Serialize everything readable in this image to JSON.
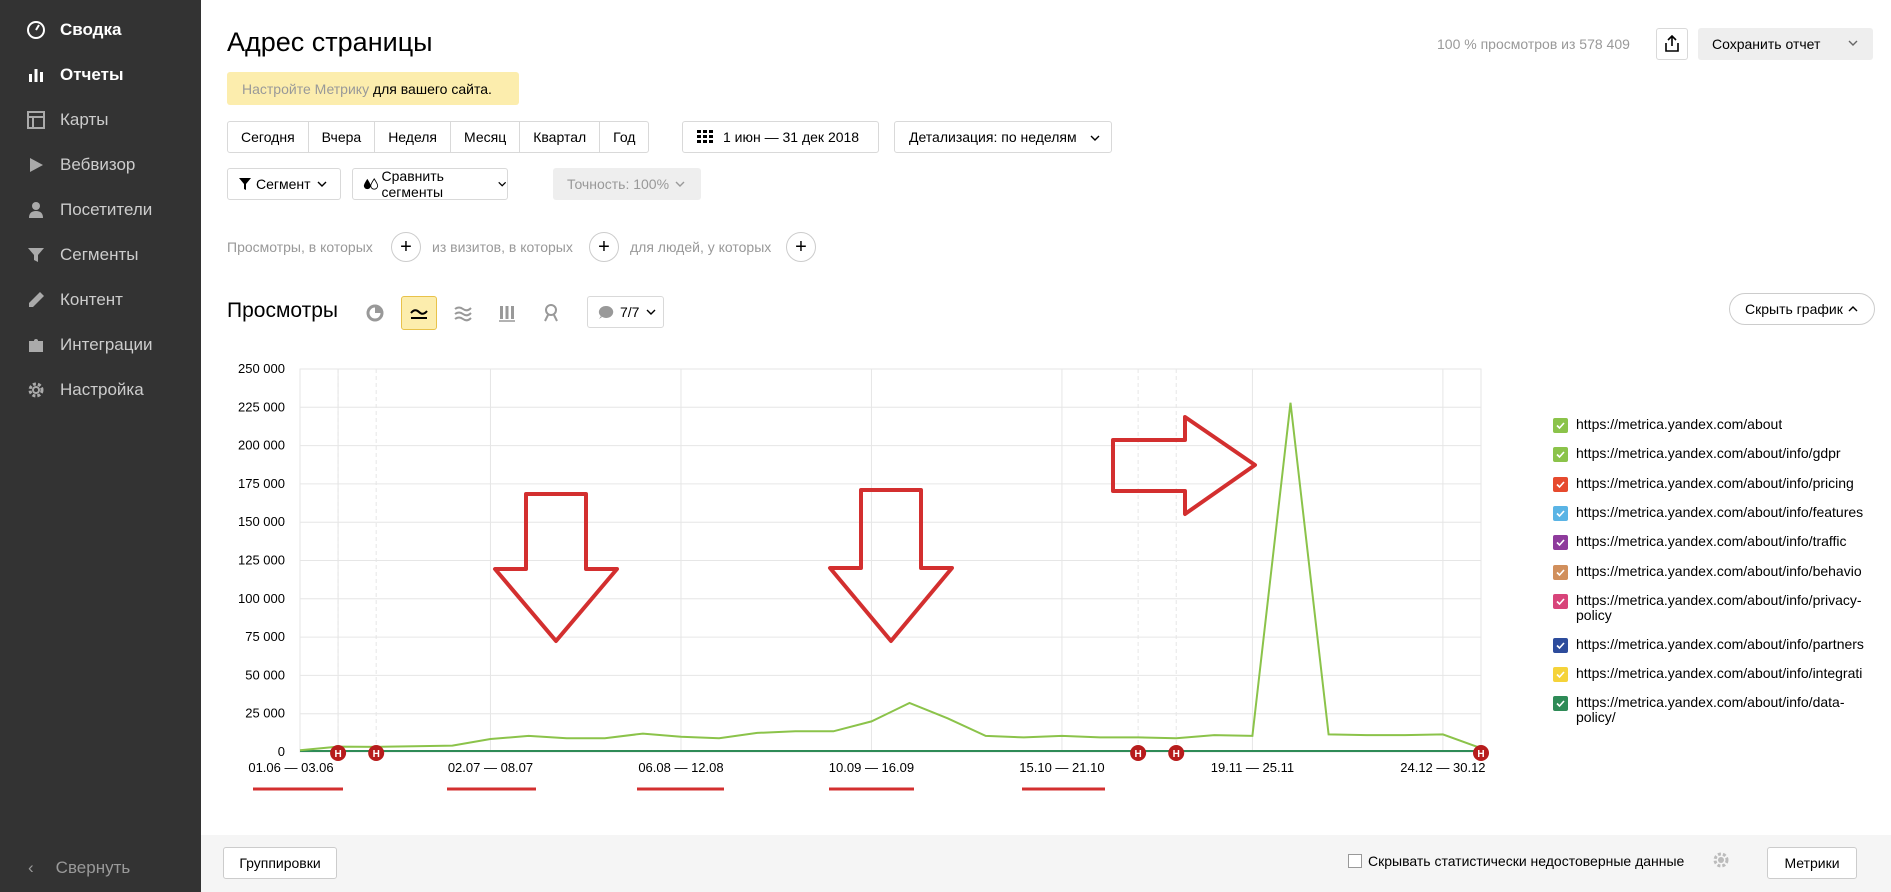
{
  "sidebar": {
    "items": [
      {
        "label": "Сводка",
        "icon": "dashboard-icon",
        "active": true
      },
      {
        "label": "Отчеты",
        "icon": "bar-chart-icon",
        "active": true
      },
      {
        "label": "Карты",
        "icon": "map-icon",
        "active": false
      },
      {
        "label": "Вебвизор",
        "icon": "play-icon",
        "active": false
      },
      {
        "label": "Посетители",
        "icon": "user-icon",
        "active": false
      },
      {
        "label": "Сегменты",
        "icon": "filter-icon",
        "active": false
      },
      {
        "label": "Контент",
        "icon": "pencil-icon",
        "active": false
      },
      {
        "label": "Интеграции",
        "icon": "puzzle-icon",
        "active": false
      },
      {
        "label": "Настройка",
        "icon": "gear-icon",
        "active": false
      }
    ],
    "collapse_label": "Свернуть"
  },
  "header": {
    "title": "Адрес страницы",
    "views_info": "100 % просмотров из 578 409",
    "save_label": "Сохранить отчет",
    "notice_link": "Настройте Метрику",
    "notice_text": " для вашего сайта."
  },
  "periods": [
    "Сегодня",
    "Вчера",
    "Неделя",
    "Месяц",
    "Квартал",
    "Год"
  ],
  "date_range": "1 июн — 31 дек 2018",
  "detail_label": "Детализация: по неделям",
  "segment_label": "Сегмент",
  "compare_label": "Сравнить сегменты",
  "accuracy_label": "Точность: 100%",
  "filters": {
    "views": "Просмотры, в которых",
    "visits": "из визитов, в которых",
    "people": "для людей, у которых"
  },
  "chart_toolbar": {
    "title": "Просмотры",
    "series_count": "7/7",
    "hide_label": "Скрыть график"
  },
  "chart_data": {
    "type": "line",
    "ylim": [
      0,
      250000
    ],
    "y_ticks": [
      "250 000",
      "225 000",
      "200 000",
      "175 000",
      "150 000",
      "125 000",
      "100 000",
      "75 000",
      "50 000",
      "25 000",
      "0"
    ],
    "x_tick_labels": [
      "01.06 — 03.06",
      "02.07 — 08.07",
      "06.08 — 12.08",
      "10.09 — 16.09",
      "15.10 — 21.10",
      "19.11 — 25.11",
      "24.12 — 30.12"
    ],
    "series": [
      {
        "color": "#8bc34a",
        "values": [
          1200,
          3500,
          3300,
          3800,
          4200,
          8500,
          10500,
          9000,
          9000,
          12000,
          10000,
          9000,
          12500,
          13500,
          13500,
          20000,
          32000,
          22000,
          10500,
          9500,
          10500,
          9500,
          9500,
          9000,
          11000,
          10500,
          228000,
          11500,
          11000,
          11000,
          11500,
          2500
        ]
      }
    ],
    "annotation_marker": "Н"
  },
  "legend": [
    {
      "label": "https://metrica.yandex.com/about",
      "color": "#8bc34a"
    },
    {
      "label": "https://metrica.yandex.com/about/info/gdpr",
      "color": "#8bc34a"
    },
    {
      "label": "https://metrica.yandex.com/about/info/pricing",
      "color": "#e64a2e"
    },
    {
      "label": "https://metrica.yandex.com/about/info/features",
      "color": "#5ab4e5"
    },
    {
      "label": "https://metrica.yandex.com/about/info/traffic",
      "color": "#8e3b9c"
    },
    {
      "label": "https://metrica.yandex.com/about/info/behavio",
      "color": "#d18f5c"
    },
    {
      "label": "https://metrica.yandex.com/about/info/privacy-policy",
      "color": "#d8447a"
    },
    {
      "label": "https://metrica.yandex.com/about/info/partners",
      "color": "#2d4c9c"
    },
    {
      "label": "https://metrica.yandex.com/about/info/integrati",
      "color": "#f5d33a"
    },
    {
      "label": "https://metrica.yandex.com/about/info/data-policy/",
      "color": "#2e8b57"
    }
  ],
  "footer": {
    "group_label": "Группировки",
    "hide_stat_label": "Скрывать статистически недостоверные данные",
    "metrics_label": "Метрики"
  }
}
